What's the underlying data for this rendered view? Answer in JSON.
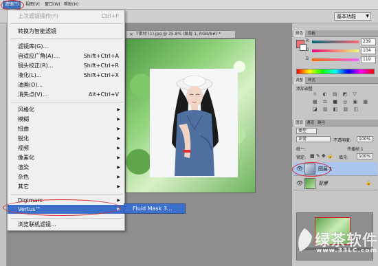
{
  "menubar": {
    "items": [
      "滤镜(T)",
      "视图(V)",
      "窗口(W)",
      "帮助(H)"
    ],
    "active_index": 0
  },
  "optionsbar": {
    "workspace": "基本功能"
  },
  "document": {
    "tab_title": "T素材 (1).jpg @ 25.8% (图层 1, RGB/8#) *"
  },
  "filter_menu": {
    "items": [
      {
        "label": "上次滤镜操作(F)",
        "shortcut": "Ctrl+F",
        "disabled": true
      },
      {
        "label": "转换为智能滤镜"
      },
      {
        "label": "滤镜库(G)..."
      },
      {
        "label": "自适应广角(A)...",
        "shortcut": "Shift+Ctrl+A"
      },
      {
        "label": "镜头校正(R)...",
        "shortcut": "Shift+Ctrl+R"
      },
      {
        "label": "液化(L)...",
        "shortcut": "Shift+Ctrl+X"
      },
      {
        "label": "油画(O)..."
      },
      {
        "label": "消失点(V)...",
        "shortcut": "Alt+Ctrl+V"
      },
      {
        "label": "风格化",
        "submenu": true
      },
      {
        "label": "模糊",
        "submenu": true
      },
      {
        "label": "扭曲",
        "submenu": true
      },
      {
        "label": "锐化",
        "submenu": true
      },
      {
        "label": "视频",
        "submenu": true
      },
      {
        "label": "像素化",
        "submenu": true
      },
      {
        "label": "渲染",
        "submenu": true
      },
      {
        "label": "杂色",
        "submenu": true
      },
      {
        "label": "其它",
        "submenu": true
      },
      {
        "label": "Digimarc",
        "submenu": true
      },
      {
        "label": "Vertus™",
        "submenu": true,
        "highlighted": true
      },
      {
        "label": "浏览联机滤镜..."
      }
    ],
    "submenu_item": "Fluid Mask 3..."
  },
  "color_panel": {
    "tabs": [
      "颜色",
      "色板"
    ],
    "r": "239",
    "g": "104",
    "b": "119",
    "fg_color": "#ef6877"
  },
  "adjust_panel": {
    "tabs": [
      "调整",
      "样式"
    ],
    "title": "添加调整"
  },
  "layers_panel": {
    "tabs": [
      "图层",
      "通道",
      "路径"
    ],
    "kind": "类型",
    "blend_mode": "正常",
    "opacity_label": "不透明度:",
    "opacity": "100%",
    "lock_label": "锁定:",
    "fill_label": "填充:",
    "fill": "100%",
    "propagate_label": "传播帧 1",
    "unify_label": "统一:",
    "layers": [
      {
        "name": "图层 1",
        "selected": true
      },
      {
        "name": "背景",
        "selected": false,
        "locked": true
      }
    ]
  },
  "watermark": {
    "text": "绿茶软件园",
    "url": "www.33LC.com"
  }
}
